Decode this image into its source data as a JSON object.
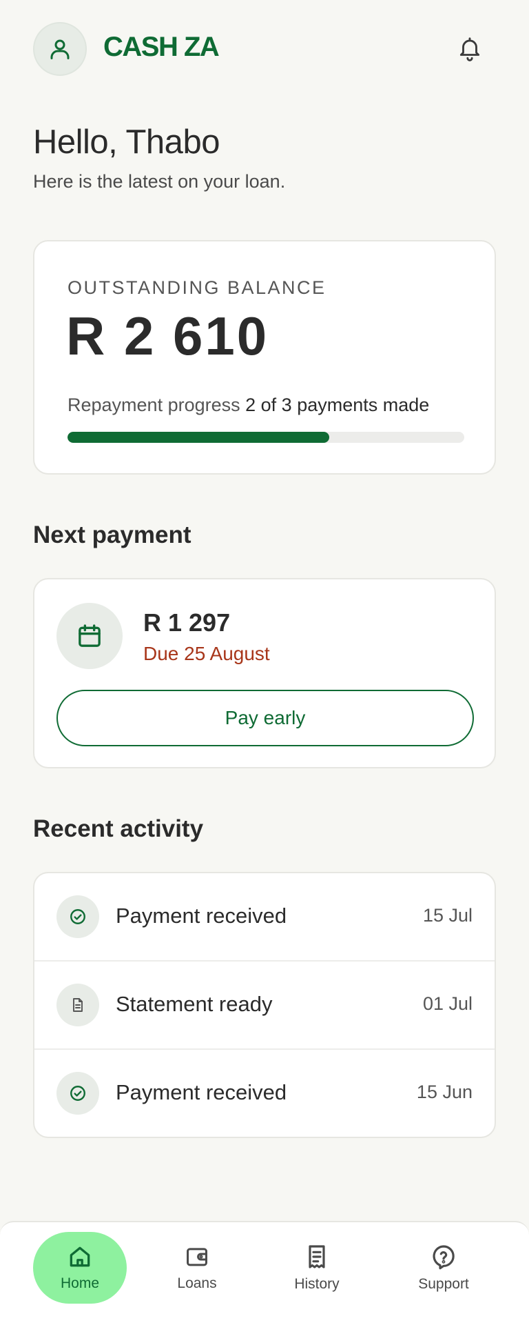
{
  "header": {
    "brand": "CASH ZA"
  },
  "greeting": {
    "title": "Hello, Thabo",
    "subtitle": "Here is the latest on your loan."
  },
  "balance": {
    "label": "OUTSTANDING BALANCE",
    "value": "R 2 610",
    "progress_label": "Repayment progress",
    "progress_status": "2 of 3 payments made",
    "progress_fraction": 0.66
  },
  "next_payment": {
    "section_title": "Next payment",
    "amount": "R 1 297",
    "due": "Due 25 August",
    "button_label": "Pay early"
  },
  "recent_activity": {
    "section_title": "Recent activity",
    "items": [
      {
        "label": "Payment received",
        "date": "15 Jul",
        "icon": "check-circle-icon"
      },
      {
        "label": "Statement ready",
        "date": "01 Jul",
        "icon": "document-icon"
      },
      {
        "label": "Payment received",
        "date": "15 Jun",
        "icon": "check-circle-icon"
      }
    ]
  },
  "nav": {
    "items": [
      {
        "label": "Home",
        "icon": "home-icon",
        "active": true
      },
      {
        "label": "Loans",
        "icon": "wallet-icon",
        "active": false
      },
      {
        "label": "History",
        "icon": "receipt-icon",
        "active": false
      },
      {
        "label": "Support",
        "icon": "help-icon",
        "active": false
      }
    ]
  },
  "colors": {
    "brand_green": "#0f6b34",
    "due_red": "#a8361a",
    "active_nav": "#8ef19f",
    "background": "#f7f7f3"
  }
}
